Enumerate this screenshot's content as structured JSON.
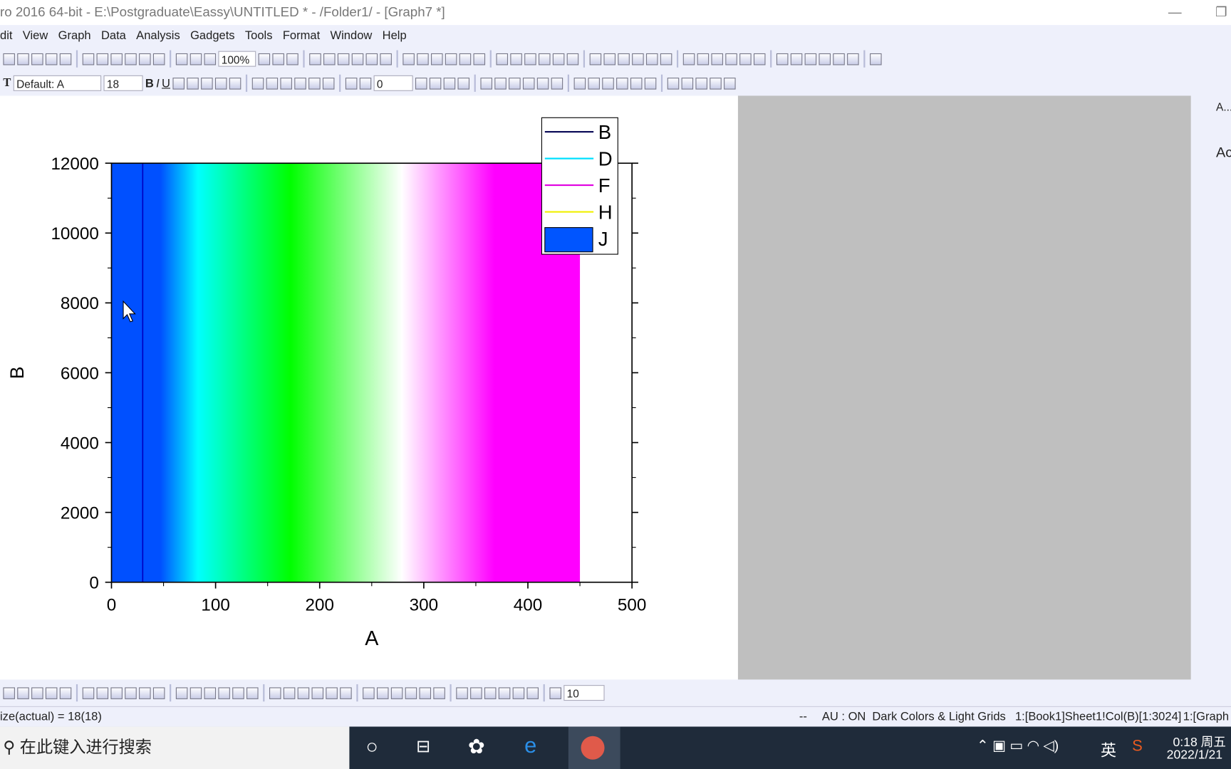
{
  "window": {
    "title": "ro 2016 64-bit - E:\\Postgraduate\\Eassy\\UNTITLED * - /Folder1/ - [Graph7 *]"
  },
  "menu": [
    "dit",
    "View",
    "Graph",
    "Data",
    "Analysis",
    "Gadgets",
    "Tools",
    "Format",
    "Window",
    "Help"
  ],
  "toolbar": {
    "zoom": "100%",
    "font": "Default: A",
    "font_size": "18",
    "line_width": "0",
    "border_width": "0",
    "bottom_field": "10"
  },
  "chart_data": {
    "type": "area",
    "xlabel": "A",
    "ylabel": "B",
    "xlim": [
      0,
      500
    ],
    "ylim": [
      0,
      12000
    ],
    "xticks": [
      "0",
      "100",
      "200",
      "300",
      "400",
      "500"
    ],
    "yticks": [
      "0",
      "2000",
      "4000",
      "6000",
      "8000",
      "10000",
      "12000"
    ],
    "legend": [
      {
        "name": "B",
        "color": "#10105a",
        "kind": "line"
      },
      {
        "name": "D",
        "color": "#00e0ff",
        "kind": "line"
      },
      {
        "name": "F",
        "color": "#e000e0",
        "kind": "line"
      },
      {
        "name": "H",
        "color": "#f0f000",
        "kind": "line"
      },
      {
        "name": "J",
        "color": "#0055ff",
        "kind": "fill"
      }
    ],
    "legend_position": "top-right",
    "fill_x_range": [
      0,
      450
    ],
    "vertical_line_x": 30,
    "colormap": [
      {
        "x": 0,
        "color": "#0050ff"
      },
      {
        "x": 47,
        "color": "#0050ff"
      },
      {
        "x": 83,
        "color": "#00ffff"
      },
      {
        "x": 172,
        "color": "#00ff00"
      },
      {
        "x": 279,
        "color": "#ffffff"
      },
      {
        "x": 368,
        "color": "#ff00ff"
      },
      {
        "x": 450,
        "color": "#ff00ff"
      }
    ]
  },
  "right_panel": {
    "tab": "A...",
    "label": "Ac"
  },
  "status": {
    "left": "ize(actual) = 18(18)",
    "dash": "--",
    "au": "AU : ON",
    "theme": "Dark Colors & Light Grids",
    "range": "1:[Book1]Sheet1!Col(B)[1:3024]",
    "graph": "1:[Graph"
  },
  "taskbar": {
    "search": "在此键入进行搜索",
    "ime": "英",
    "time": "0:18 周五",
    "date": "2022/1/21"
  }
}
